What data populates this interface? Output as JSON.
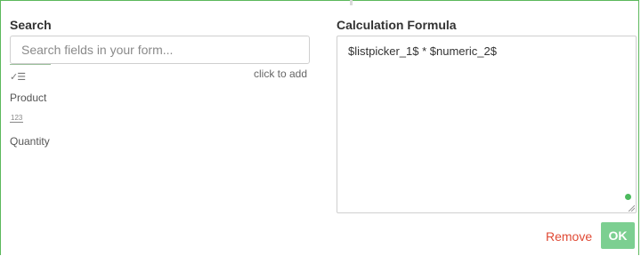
{
  "search": {
    "title": "Search",
    "placeholder": "Search fields in your form...",
    "value": "",
    "list_icon": "checklist-icon",
    "hint": "click to add",
    "fields": [
      {
        "label": "Product",
        "icon": "list-icon"
      },
      {
        "label": "Quantity",
        "icon": "numeric-icon",
        "icon_text": "123"
      }
    ]
  },
  "formula": {
    "title": "Calculation Formula",
    "value": "$listpicker_1$ * $numeric_2$",
    "status_color": "#4cba5e"
  },
  "actions": {
    "remove_label": "Remove",
    "ok_label": "OK",
    "remove_color": "#e04a35",
    "ok_color": "#7ccf91"
  },
  "colors": {
    "frame_border": "#5cb85c"
  }
}
